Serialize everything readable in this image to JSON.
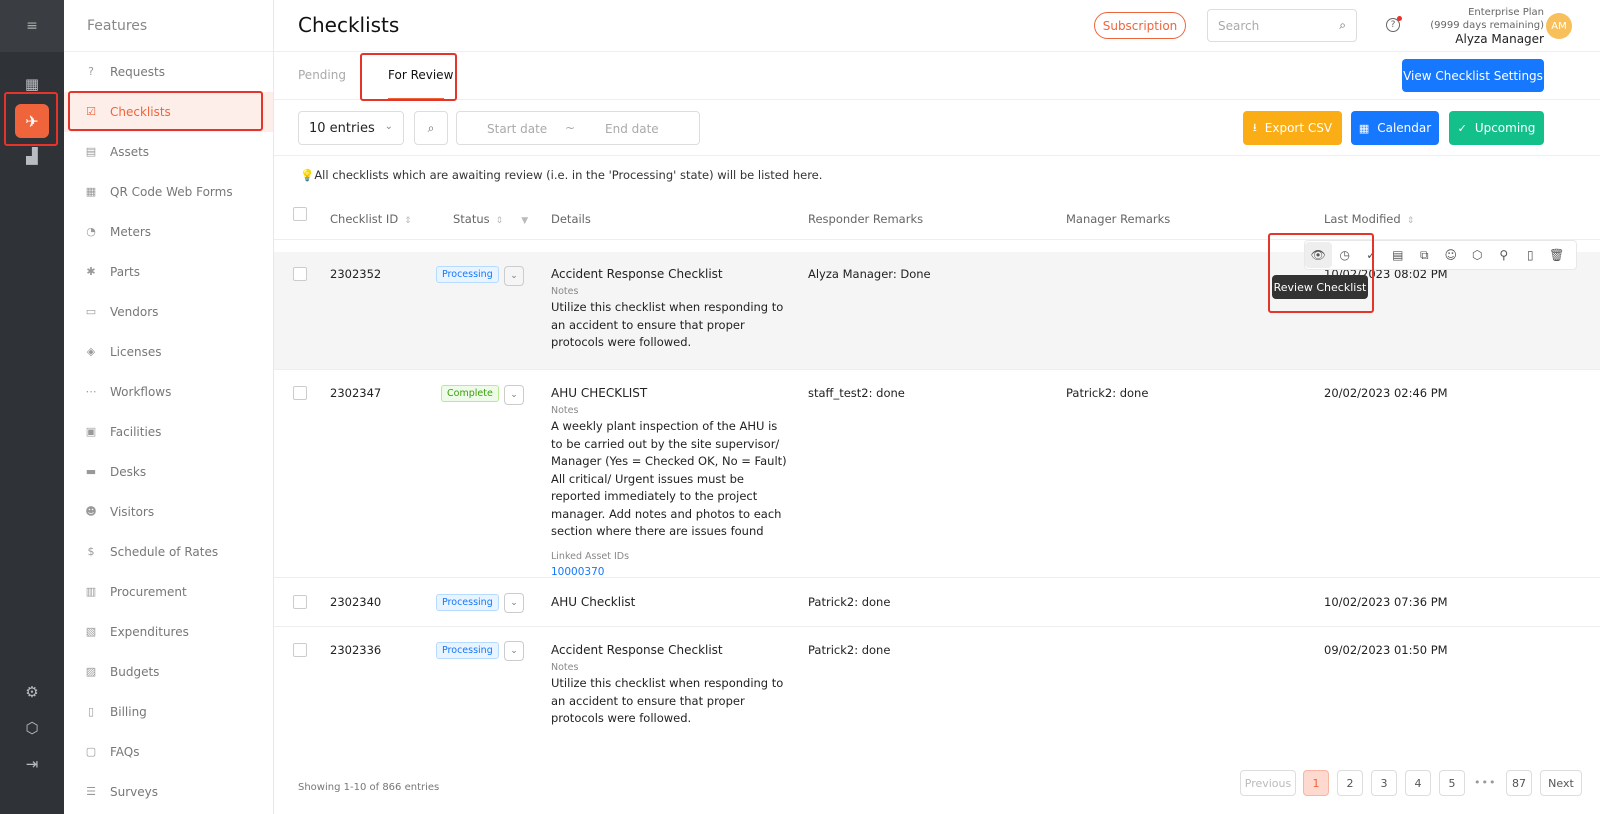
{
  "rail": {
    "menu_icon": "≡",
    "icons": [
      "dashboard-icon",
      "checklist-app-icon",
      "analytics-icon",
      "settings-icon",
      "package-icon",
      "logout-icon"
    ]
  },
  "sidebar": {
    "title": "Features",
    "items": [
      {
        "label": "Requests",
        "icon": "?"
      },
      {
        "label": "Checklists",
        "icon": "☑"
      },
      {
        "label": "Assets",
        "icon": "▤"
      },
      {
        "label": "QR Code Web Forms",
        "icon": "▦"
      },
      {
        "label": "Meters",
        "icon": "◔"
      },
      {
        "label": "Parts",
        "icon": "✱"
      },
      {
        "label": "Vendors",
        "icon": "▭"
      },
      {
        "label": "Licenses",
        "icon": "◈"
      },
      {
        "label": "Workflows",
        "icon": "⋯"
      },
      {
        "label": "Facilities",
        "icon": "▣"
      },
      {
        "label": "Desks",
        "icon": "▬"
      },
      {
        "label": "Visitors",
        "icon": "☻"
      },
      {
        "label": "Schedule of Rates",
        "icon": "$"
      },
      {
        "label": "Procurement",
        "icon": "▥"
      },
      {
        "label": "Expenditures",
        "icon": "▧"
      },
      {
        "label": "Budgets",
        "icon": "▨"
      },
      {
        "label": "Billing",
        "icon": "▯"
      },
      {
        "label": "FAQs",
        "icon": "▢"
      },
      {
        "label": "Surveys",
        "icon": "☰"
      }
    ]
  },
  "header": {
    "title": "Checklists",
    "subscription": "Subscription",
    "search_placeholder": "Search",
    "plan": "Enterprise Plan",
    "days": "(9999 days remaining)",
    "user": "Alyza Manager",
    "avatar": "AM"
  },
  "tabs": {
    "pending": "Pending",
    "for_review": "For Review",
    "view_settings": "View Checklist Settings"
  },
  "toolbar": {
    "entries": "10 entries",
    "start_date": "Start date",
    "tilde": "~",
    "end_date": "End date",
    "export": "Export CSV",
    "calendar": "Calendar",
    "upcoming": "Upcoming"
  },
  "notice": "💡All checklists which are awaiting review (i.e. in the 'Processing' state) will be listed here.",
  "table": {
    "headers": {
      "id": "Checklist ID",
      "status": "Status",
      "details": "Details",
      "responder": "Responder Remarks",
      "manager": "Manager Remarks",
      "modified": "Last Modified"
    },
    "rows": [
      {
        "id": "2302352",
        "status": "Processing",
        "title": "Accident Response Checklist",
        "notes_label": "Notes",
        "notes": "Utilize this checklist when responding to an accident to ensure that proper protocols were followed.",
        "responder": "Alyza Manager: Done",
        "manager": "",
        "modified": "10/02/2023 08:02 PM"
      },
      {
        "id": "2302347",
        "status": "Complete",
        "title": "AHU CHECKLIST",
        "notes_label": "Notes",
        "notes": "A weekly plant inspection of the AHU is to be carried out by the site supervisor/ Manager (Yes = Checked OK, No = Fault) All critical/ Urgent issues must be reported immediately to the project manager. Add notes and photos to each section where there are issues found",
        "linked_label": "Linked Asset IDs",
        "linked": "10000370",
        "responder": "staff_test2: done",
        "manager": "Patrick2: done",
        "modified": "20/02/2023 02:46 PM"
      },
      {
        "id": "2302340",
        "status": "Processing",
        "title": "AHU Checklist",
        "responder": "Patrick2: done",
        "manager": "",
        "modified": "10/02/2023 07:36 PM"
      },
      {
        "id": "2302336",
        "status": "Processing",
        "title": "Accident Response Checklist",
        "notes_label": "Notes",
        "notes": "Utilize this checklist when responding to an accident to ensure that proper protocols were followed.",
        "responder": "Patrick2: done",
        "manager": "",
        "modified": "09/02/2023 01:50 PM"
      }
    ]
  },
  "actions": {
    "icons": [
      "eye-icon",
      "history-icon",
      "check-circle-icon",
      "report-icon",
      "copy-icon",
      "assign-user-icon",
      "box-icon",
      "link-icon",
      "pdf-icon",
      "trash-icon"
    ],
    "glyphs": [
      "👁",
      "◷",
      "✓",
      "▤",
      "⧉",
      "☺",
      "⬡",
      "⚲",
      "▯",
      "🗑"
    ],
    "tooltip": "Review Checklist"
  },
  "pagination": {
    "showing": "Showing 1-10 of 866 entries",
    "previous": "Previous",
    "pages": [
      "1",
      "2",
      "3",
      "4",
      "5"
    ],
    "ellipsis": "•••",
    "last": "87",
    "next": "Next"
  },
  "colors": {
    "brand": "#f0643c",
    "primary": "#1677ff",
    "export": "#faad14",
    "upcoming": "#13c08a"
  }
}
